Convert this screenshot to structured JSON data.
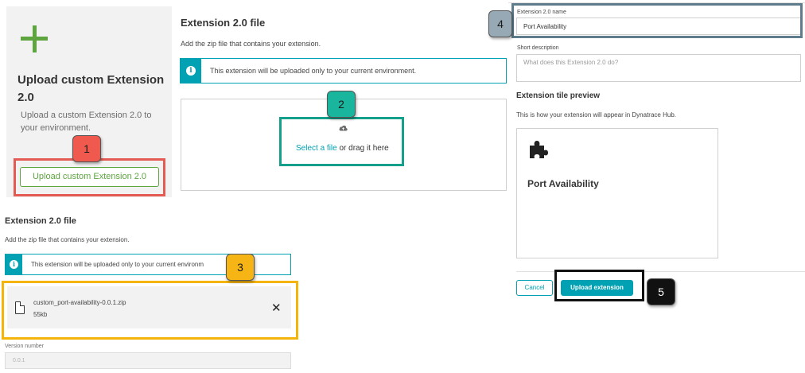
{
  "upload_card": {
    "title": "Upload custom Extension 2.0",
    "description": "Upload a custom Extension 2.0 to your environment.",
    "button_label": "Upload custom Extension 2.0"
  },
  "dialog_top": {
    "heading": "Extension 2.0 file",
    "subtext": "Add the zip file that contains your extension.",
    "info_text": "This extension will be uploaded only to your current environment.",
    "dropzone_link": "Select a file",
    "dropzone_rest": " or drag it here"
  },
  "dialog_bottom": {
    "heading": "Extension 2.0 file",
    "subtext": "Add the zip file that contains your extension.",
    "info_text": "This extension will be uploaded only to your current environm",
    "file_name": "custom_port-availability-0.0.1.zip",
    "file_size": "55kb",
    "version_label": "Version number",
    "version_value": "0.0.1"
  },
  "right_panel": {
    "name_label": "Extension 2.0 name",
    "name_value": "Port Availability",
    "desc_label": "Short description",
    "desc_placeholder": "What does this Extension 2.0 do?",
    "preview_heading": "Extension tile preview",
    "preview_sub": "This is how your extension will appear in Dynatrace Hub.",
    "tile_title": "Port Availability",
    "cancel_label": "Cancel",
    "upload_label": "Upload extension"
  },
  "badges": [
    "1",
    "2",
    "3",
    "4",
    "5"
  ],
  "colors": {
    "accent_teal": "#00a1b2",
    "accent_green": "#5ea53f",
    "callout_red": "#e35b52",
    "callout_teal": "#14a08a",
    "callout_yellow": "#f5b40a",
    "callout_slate": "#5e7c8c",
    "callout_black": "#111111"
  },
  "icons": [
    "plus-icon",
    "info-icon",
    "cloud-upload-icon",
    "file-icon",
    "close-icon",
    "puzzle-icon"
  ]
}
